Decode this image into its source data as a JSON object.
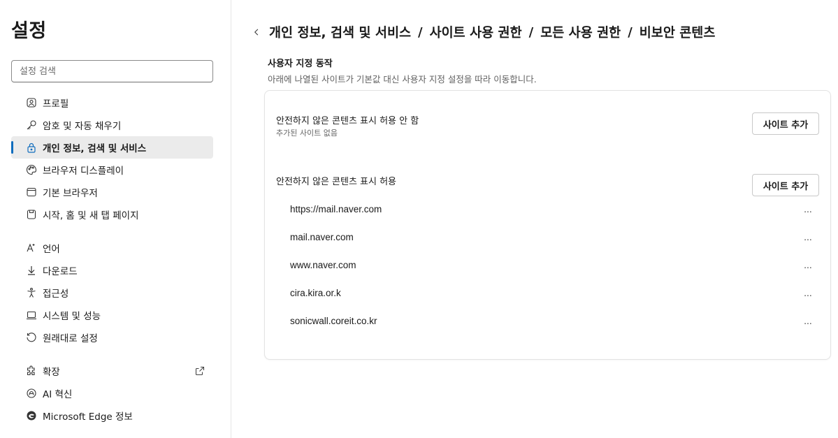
{
  "sidebar": {
    "title": "설정",
    "search_placeholder": "설정 검색",
    "items": [
      {
        "label": "프로필",
        "icon": "profile-icon"
      },
      {
        "label": "암호 및 자동 채우기",
        "icon": "key-icon"
      },
      {
        "label": "개인 정보, 검색 및 서비스",
        "icon": "lock-icon",
        "active": true
      },
      {
        "label": "브라우저 디스플레이",
        "icon": "palette-icon"
      },
      {
        "label": "기본 브라우저",
        "icon": "browser-icon"
      },
      {
        "label": "시작, 홈 및 새 탭 페이지",
        "icon": "home-tabs-icon"
      },
      {
        "label": "언어",
        "icon": "language-icon"
      },
      {
        "label": "다운로드",
        "icon": "download-icon"
      },
      {
        "label": "접근성",
        "icon": "accessibility-icon"
      },
      {
        "label": "시스템 및 성능",
        "icon": "laptop-icon"
      },
      {
        "label": "원래대로 설정",
        "icon": "reset-icon"
      },
      {
        "label": "확장",
        "icon": "puzzle-icon",
        "external": true
      },
      {
        "label": "AI 혁신",
        "icon": "ai-icon"
      },
      {
        "label": "Microsoft Edge 정보",
        "icon": "edge-icon"
      }
    ]
  },
  "breadcrumb": {
    "items": [
      "개인 정보, 검색 및 서비스",
      "사이트 사용 권한",
      "모든 사용 권한",
      "비보안 콘텐츠"
    ],
    "separator": "/"
  },
  "section": {
    "title": "사용자 지정 동작",
    "description": "아래에 나열된 사이트가 기본값 대신 사용자 지정 설정을 따라 이동합니다."
  },
  "block_block": {
    "title": "안전하지 않은 콘텐츠 표시 허용 안 함",
    "empty_text": "추가된 사이트 없음",
    "button": "사이트 추가"
  },
  "block_allow": {
    "title": "안전하지 않은 콘텐츠 표시 허용",
    "button": "사이트 추가",
    "sites": [
      "https://mail.naver.com",
      "mail.naver.com",
      "www.naver.com",
      "cira.kira.or.k",
      "sonicwall.coreit.co.kr"
    ],
    "more_label": "..."
  },
  "colors": {
    "accent": "#0f6cbd",
    "active_bg": "#ebebeb",
    "text": "#1a1a1a",
    "muted": "#616161"
  }
}
